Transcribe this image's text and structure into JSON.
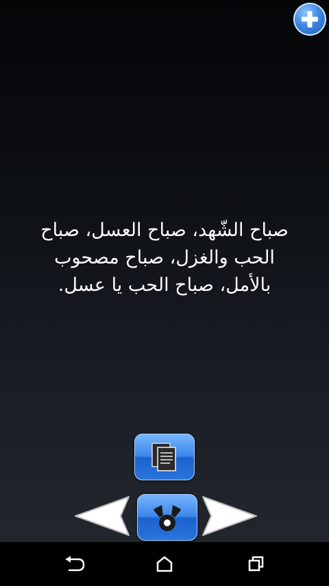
{
  "quote": {
    "text": "صباح الشّهد، صباح العسل، صباح الحب والغزل، صباح مصحوب بالأمل، صباح الحب يا عسل."
  },
  "icons": {
    "add": "plus-circle-icon",
    "copy": "copy-pages-icon",
    "share": "share-icon",
    "previous": "left-arrow-icon",
    "next": "right-arrow-icon",
    "nav_back": "back-icon",
    "nav_home": "home-icon",
    "nav_recent": "recent-apps-icon"
  },
  "colors": {
    "button_blue": "#3a86ea",
    "text": "#ffffff",
    "background_top": "#040507",
    "background_bottom": "#22262d"
  }
}
